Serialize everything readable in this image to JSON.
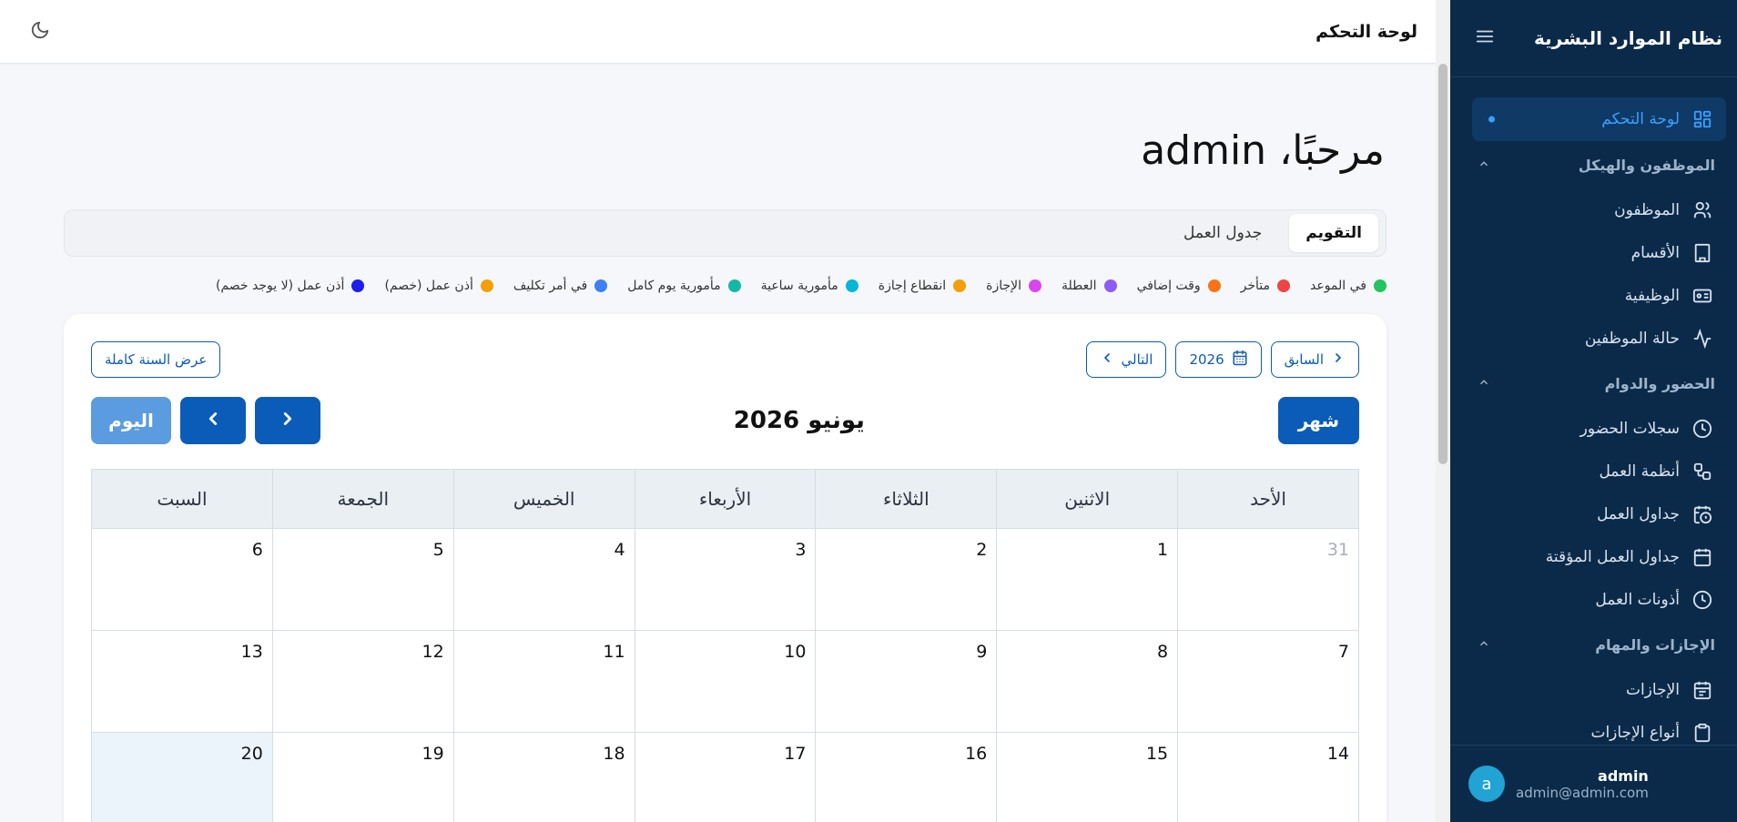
{
  "sidebar": {
    "title": "نظام الموارد البشرية",
    "items": [
      {
        "type": "item",
        "label": "لوحة التحكم",
        "icon": "dashboard-icon",
        "active": true
      },
      {
        "type": "section",
        "label": "الموظفون والهيكل"
      },
      {
        "type": "item",
        "label": "الموظفون",
        "icon": "users-icon"
      },
      {
        "type": "item",
        "label": "الأقسام",
        "icon": "building-icon"
      },
      {
        "type": "item",
        "label": "الوظيفية",
        "icon": "id-card-icon"
      },
      {
        "type": "item",
        "label": "حالة الموظفين",
        "icon": "activity-icon"
      },
      {
        "type": "section",
        "label": "الحضور والدوام"
      },
      {
        "type": "item",
        "label": "سجلات الحضور",
        "icon": "clock-icon"
      },
      {
        "type": "item",
        "label": "أنظمة العمل",
        "icon": "workflow-icon"
      },
      {
        "type": "item",
        "label": "جداول العمل",
        "icon": "calendar-clock-icon"
      },
      {
        "type": "item",
        "label": "جداول العمل المؤقتة",
        "icon": "calendar-icon"
      },
      {
        "type": "item",
        "label": "أذونات العمل",
        "icon": "clock-icon"
      },
      {
        "type": "section",
        "label": "الإجازات والمهام"
      },
      {
        "type": "item",
        "label": "الإجازات",
        "icon": "calendar-check-icon"
      },
      {
        "type": "item",
        "label": "أنواع الإجازات",
        "icon": "clipboard-icon"
      }
    ],
    "user": {
      "initial": "a",
      "name": "admin",
      "email": "admin@admin.com"
    }
  },
  "topbar": {
    "title": "لوحة التحكم"
  },
  "welcome": "مرحبًا، admin",
  "tabs": [
    {
      "label": "التقويم",
      "active": true
    },
    {
      "label": "جدول العمل",
      "active": false
    }
  ],
  "legend": [
    {
      "label": "في الموعد",
      "color": "#22c55e"
    },
    {
      "label": "متأخر",
      "color": "#ef4444"
    },
    {
      "label": "وقت إضافي",
      "color": "#f97316"
    },
    {
      "label": "العطلة",
      "color": "#8b5cf6"
    },
    {
      "label": "الإجازة",
      "color": "#d946ef"
    },
    {
      "label": "انقطاع إجازة",
      "color": "#f59e0b"
    },
    {
      "label": "مأمورية ساعية",
      "color": "#06b6d4"
    },
    {
      "label": "مأمورية يوم كامل",
      "color": "#14b8a6"
    },
    {
      "label": "في أمر تكليف",
      "color": "#3b82f6"
    },
    {
      "label": "أذن عمل (خصم)",
      "color": "#f59e0b"
    },
    {
      "label": "أذن عمل (لا يوجد خصم)",
      "color": "#1d1df0"
    }
  ],
  "calendar": {
    "prev_label": "السابق",
    "year_label": "2026",
    "next_label": "التالي",
    "full_year_label": "عرض السنة كاملة",
    "month_button": "شهر",
    "title": "يونيو 2026",
    "today_button": "اليوم",
    "weekdays": [
      "الأحد",
      "الاثنين",
      "الثلاثاء",
      "الأربعاء",
      "الخميس",
      "الجمعة",
      "السبت"
    ],
    "weeks": [
      [
        "31",
        "1",
        "2",
        "3",
        "4",
        "5",
        "6"
      ],
      [
        "7",
        "8",
        "9",
        "10",
        "11",
        "12",
        "13"
      ],
      [
        "14",
        "15",
        "16",
        "17",
        "18",
        "19",
        "20"
      ]
    ]
  }
}
